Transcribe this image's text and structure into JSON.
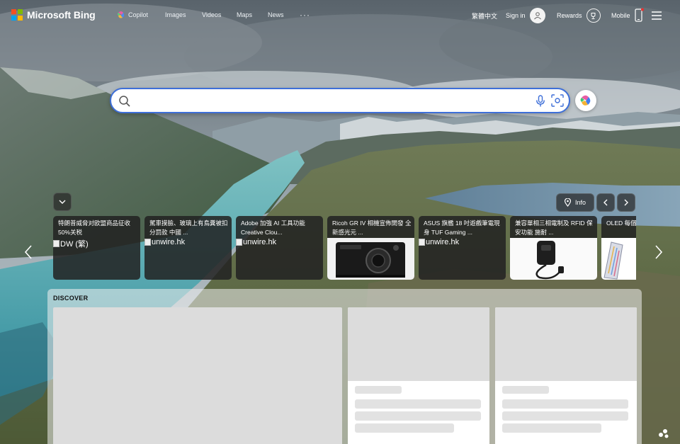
{
  "header": {
    "brand": "Microsoft Bing",
    "brand_colors": [
      "#f25022",
      "#7fba00",
      "#00a4ef",
      "#ffb900"
    ],
    "nav": [
      {
        "label": "Copilot"
      },
      {
        "label": "Images"
      },
      {
        "label": "Videos"
      },
      {
        "label": "Maps"
      },
      {
        "label": "News"
      }
    ],
    "more": "···",
    "language": "繁體中文",
    "signin": "Sign in",
    "rewards": "Rewards",
    "mobile": "Mobile",
    "menu_icon": "hamburger-icon"
  },
  "search": {
    "placeholder": "",
    "value": "",
    "accent": "#3e6fd8"
  },
  "carousel": {
    "info_label": "Info",
    "cards": [
      {
        "title": "特朗普威脅对欧盟商品征收50%关税",
        "source": "DW (繁)",
        "has_image": false
      },
      {
        "title": "駕車摸臉、玻璃上有鳥糞被扣分罰款 中國 ...",
        "source": "unwire.hk",
        "has_image": false
      },
      {
        "title": "Adobe 加強 AI 工具功能 Creative Clou...",
        "source": "unwire.hk",
        "has_image": false
      },
      {
        "title": "Ricoh GR IV 相機宣佈開發 全新感光元 ...",
        "source": "",
        "has_image": true,
        "image_kind": "camera"
      },
      {
        "title": "ASUS 旗艦 18 吋遊戲筆電現身 TUF Gaming ...",
        "source": "unwire.hk",
        "has_image": false
      },
      {
        "title": "兼容單相三相電制及 RFID 保安功能 施耐 ...",
        "source": "",
        "has_image": true,
        "image_kind": "charger"
      },
      {
        "title": "OLED 每個像素 音 韓國開發",
        "source": "",
        "has_image": true,
        "image_kind": "panel"
      }
    ]
  },
  "discover": {
    "title": "DISCOVER"
  }
}
